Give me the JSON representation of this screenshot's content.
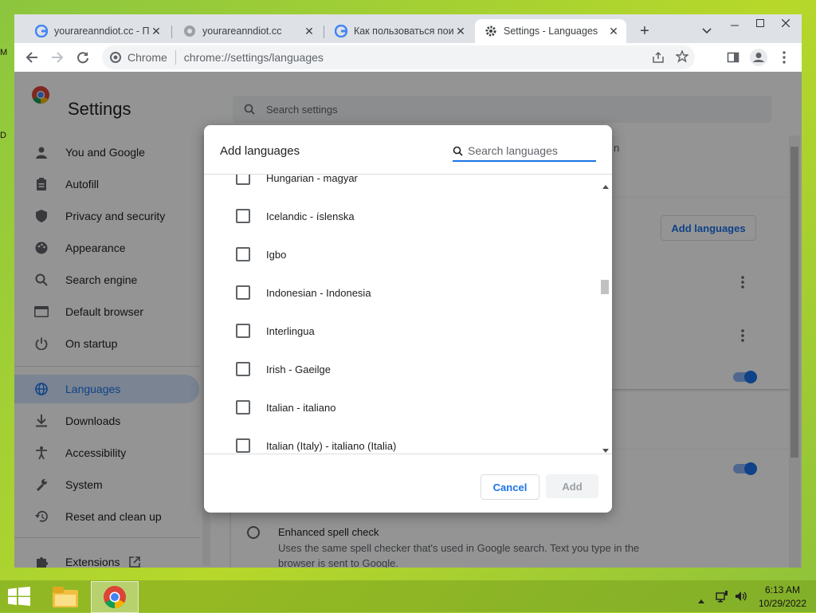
{
  "desktop": {
    "edge_letters": [
      "M",
      "D"
    ]
  },
  "tabs": [
    {
      "title": "yourareanndiot.cc - По",
      "active": false,
      "icon": "google-icon"
    },
    {
      "title": "yourareanndiot.cc",
      "active": false,
      "icon": "globe-icon"
    },
    {
      "title": "Как пользоваться пои",
      "active": false,
      "icon": "google-icon"
    },
    {
      "title": "Settings - Languages",
      "active": true,
      "icon": "gear-icon"
    }
  ],
  "omnibox": {
    "site_label": "Chrome",
    "url": "chrome://settings/languages"
  },
  "settings": {
    "title": "Settings",
    "search_placeholder": "Search settings",
    "nav": [
      {
        "label": "You and Google",
        "icon": "person-icon"
      },
      {
        "label": "Autofill",
        "icon": "clipboard-icon"
      },
      {
        "label": "Privacy and security",
        "icon": "shield-icon"
      },
      {
        "label": "Appearance",
        "icon": "palette-icon"
      },
      {
        "label": "Search engine",
        "icon": "search-icon"
      },
      {
        "label": "Default browser",
        "icon": "browser-icon"
      },
      {
        "label": "On startup",
        "icon": "power-icon"
      },
      {
        "label": "Languages",
        "icon": "globe-icon",
        "selected": true
      },
      {
        "label": "Downloads",
        "icon": "download-icon"
      },
      {
        "label": "Accessibility",
        "icon": "accessibility-icon"
      },
      {
        "label": "System",
        "icon": "wrench-icon"
      },
      {
        "label": "Reset and clean up",
        "icon": "restore-icon"
      },
      {
        "label": "Extensions",
        "icon": "puzzle-icon",
        "external": true
      }
    ],
    "add_languages_button": "Add languages",
    "partial_text_n": "n",
    "spell_check": {
      "title": "Enhanced spell check",
      "description_line1": "Uses the same spell checker that's used in Google search. Text you type in the",
      "description_line2": "browser is sent to Google."
    }
  },
  "dialog": {
    "title": "Add languages",
    "search_placeholder": "Search languages",
    "languages": [
      {
        "label": "Hungarian - magyar",
        "checked": false
      },
      {
        "label": "Icelandic - íslenska",
        "checked": false
      },
      {
        "label": "Igbo",
        "checked": false
      },
      {
        "label": "Indonesian - Indonesia",
        "checked": false
      },
      {
        "label": "Interlingua",
        "checked": false
      },
      {
        "label": "Irish - Gaeilge",
        "checked": false
      },
      {
        "label": "Italian - italiano",
        "checked": false
      },
      {
        "label": "Italian (Italy) - italiano (Italia)",
        "checked": false
      }
    ],
    "cancel_label": "Cancel",
    "add_label": "Add"
  },
  "taskbar": {
    "time": "6:13 AM",
    "date": "10/29/2022"
  },
  "colors": {
    "accent": "#1a73e8",
    "desktop": "#9ccc3a",
    "dim": "rgba(0,0,0,0.42)"
  }
}
